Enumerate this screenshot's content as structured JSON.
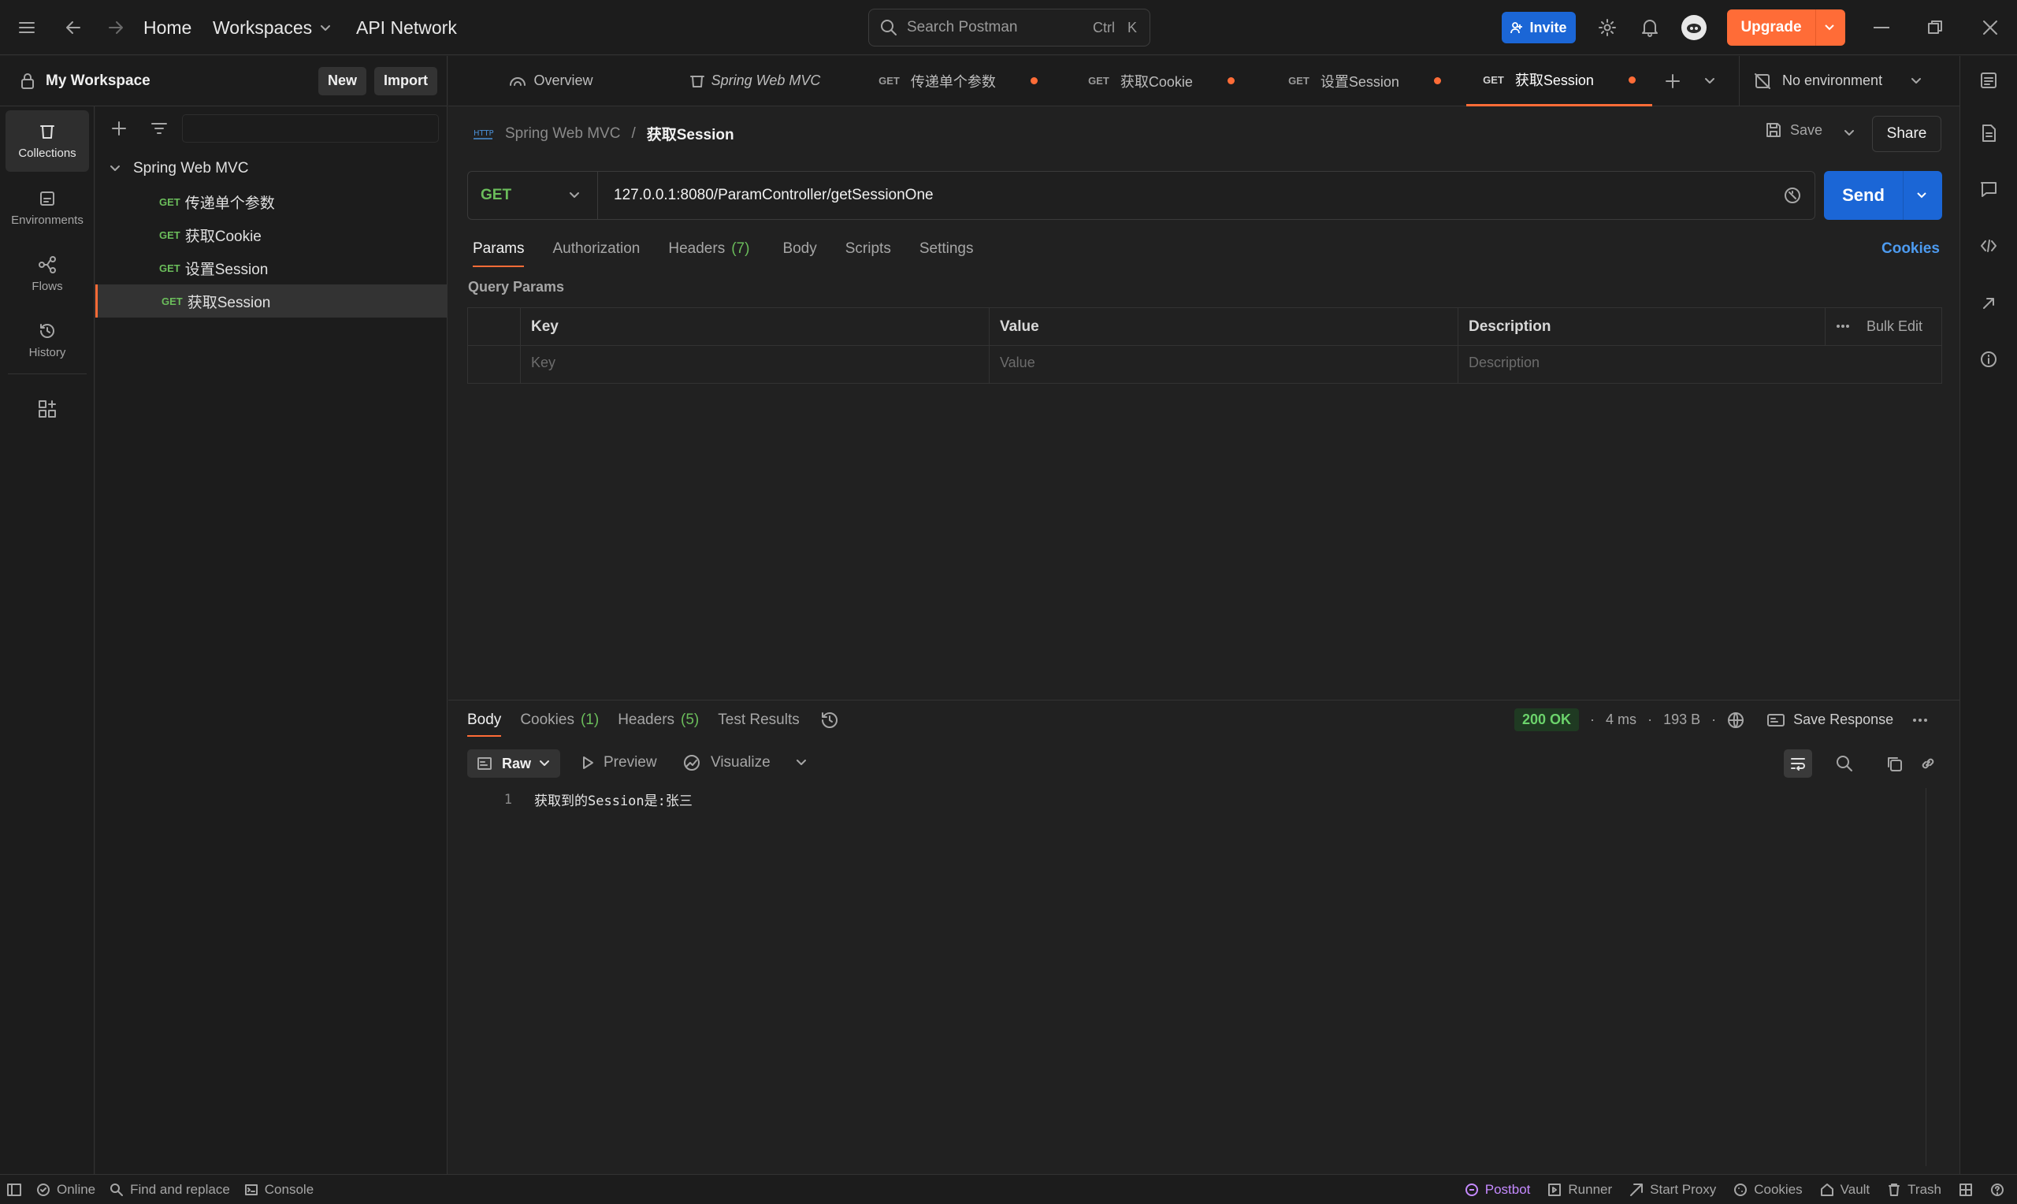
{
  "topbar": {
    "home": "Home",
    "workspaces": "Workspaces",
    "api_network": "API Network",
    "search_placeholder": "Search Postman",
    "search_kbd_1": "Ctrl",
    "search_kbd_2": "K",
    "invite": "Invite",
    "upgrade": "Upgrade"
  },
  "workspace": {
    "name": "My Workspace",
    "new_label": "New",
    "import_label": "Import"
  },
  "rail": {
    "collections": "Collections",
    "environments": "Environments",
    "flows": "Flows",
    "history": "History"
  },
  "tree": {
    "collection": "Spring Web MVC",
    "items": [
      {
        "method": "GET",
        "label": "传递单个参数"
      },
      {
        "method": "GET",
        "label": "获取Cookie"
      },
      {
        "method": "GET",
        "label": "设置Session"
      },
      {
        "method": "GET",
        "label": "获取Session"
      }
    ]
  },
  "tabs": {
    "overview": "Overview",
    "collection": "Spring Web MVC",
    "t1": {
      "method": "GET",
      "label": "传递单个参数"
    },
    "t2": {
      "method": "GET",
      "label": "获取Cookie"
    },
    "t3": {
      "method": "GET",
      "label": "设置Session"
    },
    "t4": {
      "method": "GET",
      "label": "获取Session"
    },
    "environment": "No environment"
  },
  "request": {
    "breadcrumb_collection": "Spring Web MVC",
    "breadcrumb_sep": "/",
    "name": "获取Session",
    "save_label": "Save",
    "share_label": "Share",
    "method": "GET",
    "url": "127.0.0.1:8080/ParamController/getSessionOne",
    "send_label": "Send",
    "subtabs": {
      "params": "Params",
      "authorization": "Authorization",
      "headers": "Headers",
      "headers_count": "(7)",
      "body": "Body",
      "scripts": "Scripts",
      "settings": "Settings",
      "cookies": "Cookies"
    },
    "query_params_title": "Query Params",
    "columns": {
      "key": "Key",
      "value": "Value",
      "description": "Description",
      "bulk_edit": "Bulk Edit"
    },
    "placeholders": {
      "key": "Key",
      "value": "Value",
      "description": "Description"
    }
  },
  "response": {
    "tabs": {
      "body": "Body",
      "cookies": "Cookies",
      "cookies_count": "(1)",
      "headers": "Headers",
      "headers_count": "(5)",
      "test_results": "Test Results"
    },
    "status": "200 OK",
    "time": "4 ms",
    "size": "193 B",
    "save_response": "Save Response",
    "format_raw": "Raw",
    "preview": "Preview",
    "visualize": "Visualize",
    "lines": [
      {
        "num": "1",
        "text": "获取到的Session是:张三"
      }
    ]
  },
  "statusbar": {
    "online": "Online",
    "find_replace": "Find and replace",
    "console": "Console",
    "postbot": "Postbot",
    "runner": "Runner",
    "start_proxy": "Start Proxy",
    "cookies": "Cookies",
    "vault": "Vault",
    "trash": "Trash"
  },
  "colors": {
    "accent": "#ff6c37",
    "primary": "#1b66d6",
    "get": "#6bbd5b"
  }
}
